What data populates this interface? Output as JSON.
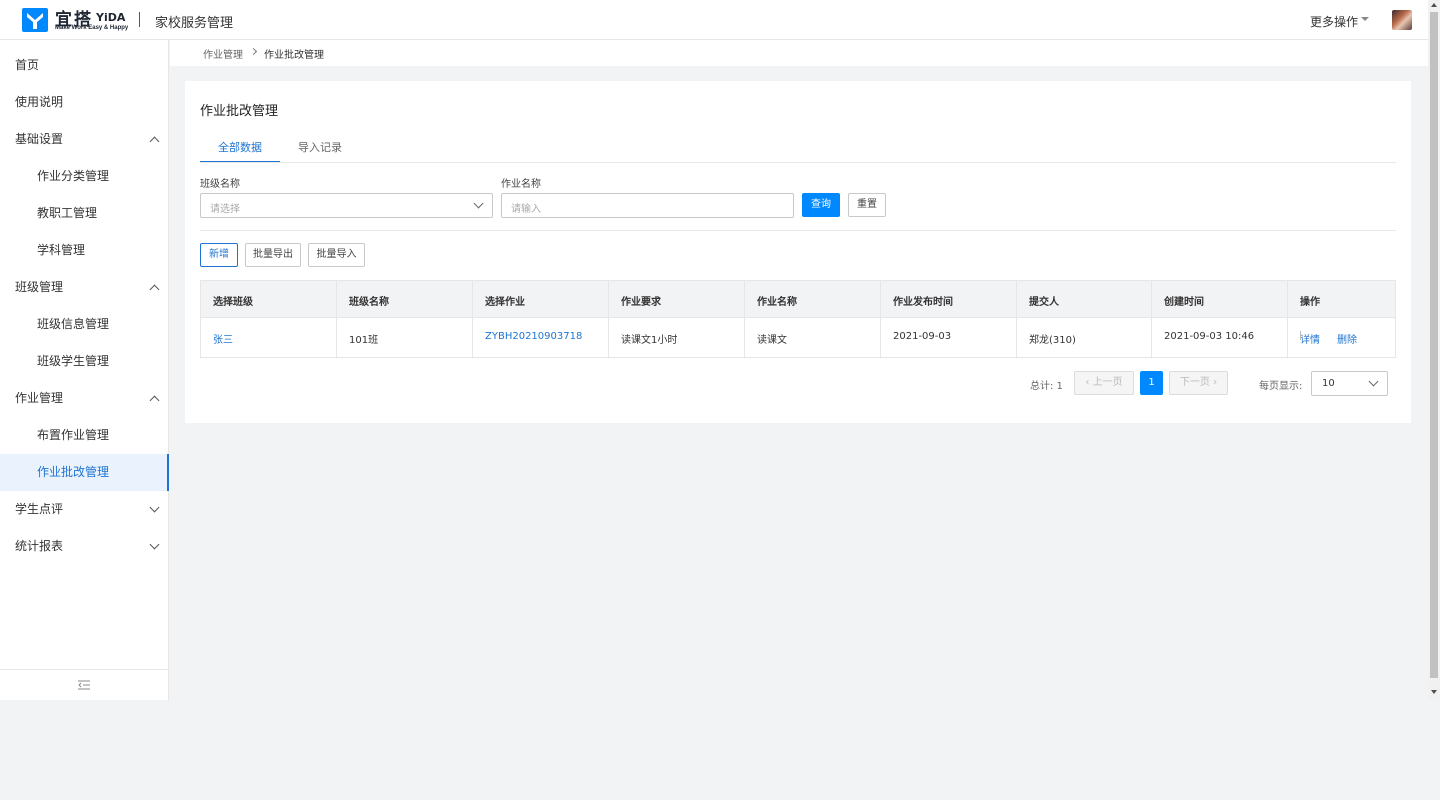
{
  "header": {
    "logo_cn": "宜搭",
    "logo_en": "YiDA",
    "logo_slogan": "Make Work Easy & Happy",
    "app_title": "家校服务管理",
    "more_ops": "更多操作"
  },
  "sidebar": {
    "items": [
      {
        "label": "首页"
      },
      {
        "label": "使用说明"
      },
      {
        "label": "基础设置"
      },
      {
        "label": "作业分类管理"
      },
      {
        "label": "教职工管理"
      },
      {
        "label": "学科管理"
      },
      {
        "label": "班级管理"
      },
      {
        "label": "班级信息管理"
      },
      {
        "label": "班级学生管理"
      },
      {
        "label": "作业管理"
      },
      {
        "label": "布置作业管理"
      },
      {
        "label": "作业批改管理"
      },
      {
        "label": "学生点评"
      },
      {
        "label": "统计报表"
      }
    ]
  },
  "breadcrumb": {
    "parent": "作业管理",
    "current": "作业批改管理"
  },
  "main": {
    "title": "作业批改管理",
    "tabs": [
      {
        "label": "全部数据"
      },
      {
        "label": "导入记录"
      }
    ],
    "filters": {
      "class_label": "班级名称",
      "class_placeholder": "请选择",
      "hw_label": "作业名称",
      "hw_placeholder": "请输入",
      "query": "查询",
      "reset": "重置"
    },
    "actions": {
      "add": "新增",
      "export": "批量导出",
      "import": "批量导入"
    },
    "table": {
      "headers": [
        "选择班级",
        "班级名称",
        "选择作业",
        "作业要求",
        "作业名称",
        "作业发布时间",
        "提交人",
        "创建时间",
        "操作"
      ],
      "rows": [
        {
          "cells": [
            "张三",
            "101班",
            "ZYBH20210903718",
            "读课文1小时",
            "读课文",
            "2021-09-03",
            "郑龙(310)",
            "2021-09-03 10:46"
          ],
          "op_detail": "详情",
          "op_delete": "删除"
        }
      ]
    },
    "pagination": {
      "total": "总计: 1",
      "prev": "上一页",
      "next": "下一页",
      "current": "1",
      "per_page_label": "每页显示:",
      "per_page": "10"
    }
  },
  "colors": {
    "primary": "#0089ff",
    "link": "#1f74d1",
    "active_bg": "#eaf3fd"
  }
}
